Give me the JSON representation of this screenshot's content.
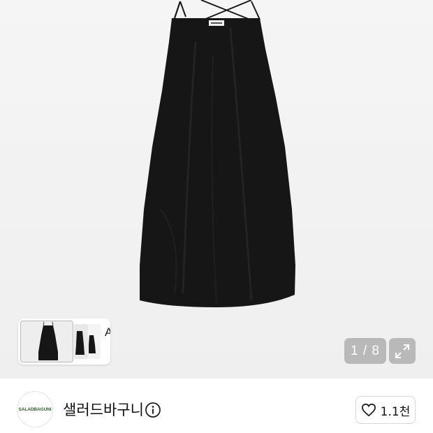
{
  "product": {
    "image_alt": "black slip dress"
  },
  "gallery": {
    "thumbnail_badge": "AI",
    "counter": "1 / 8",
    "current_page": 1,
    "total_pages": 8
  },
  "seller": {
    "logo_text": "SALADBAGUNI",
    "name": "샐러드바구니",
    "likes": "1.1천"
  },
  "colors": {
    "dress": "#161616",
    "brand_green": "#2f5c2f"
  },
  "icons": [
    "expand-icon",
    "info-icon",
    "heart-icon",
    "chevron-right-icon"
  ]
}
